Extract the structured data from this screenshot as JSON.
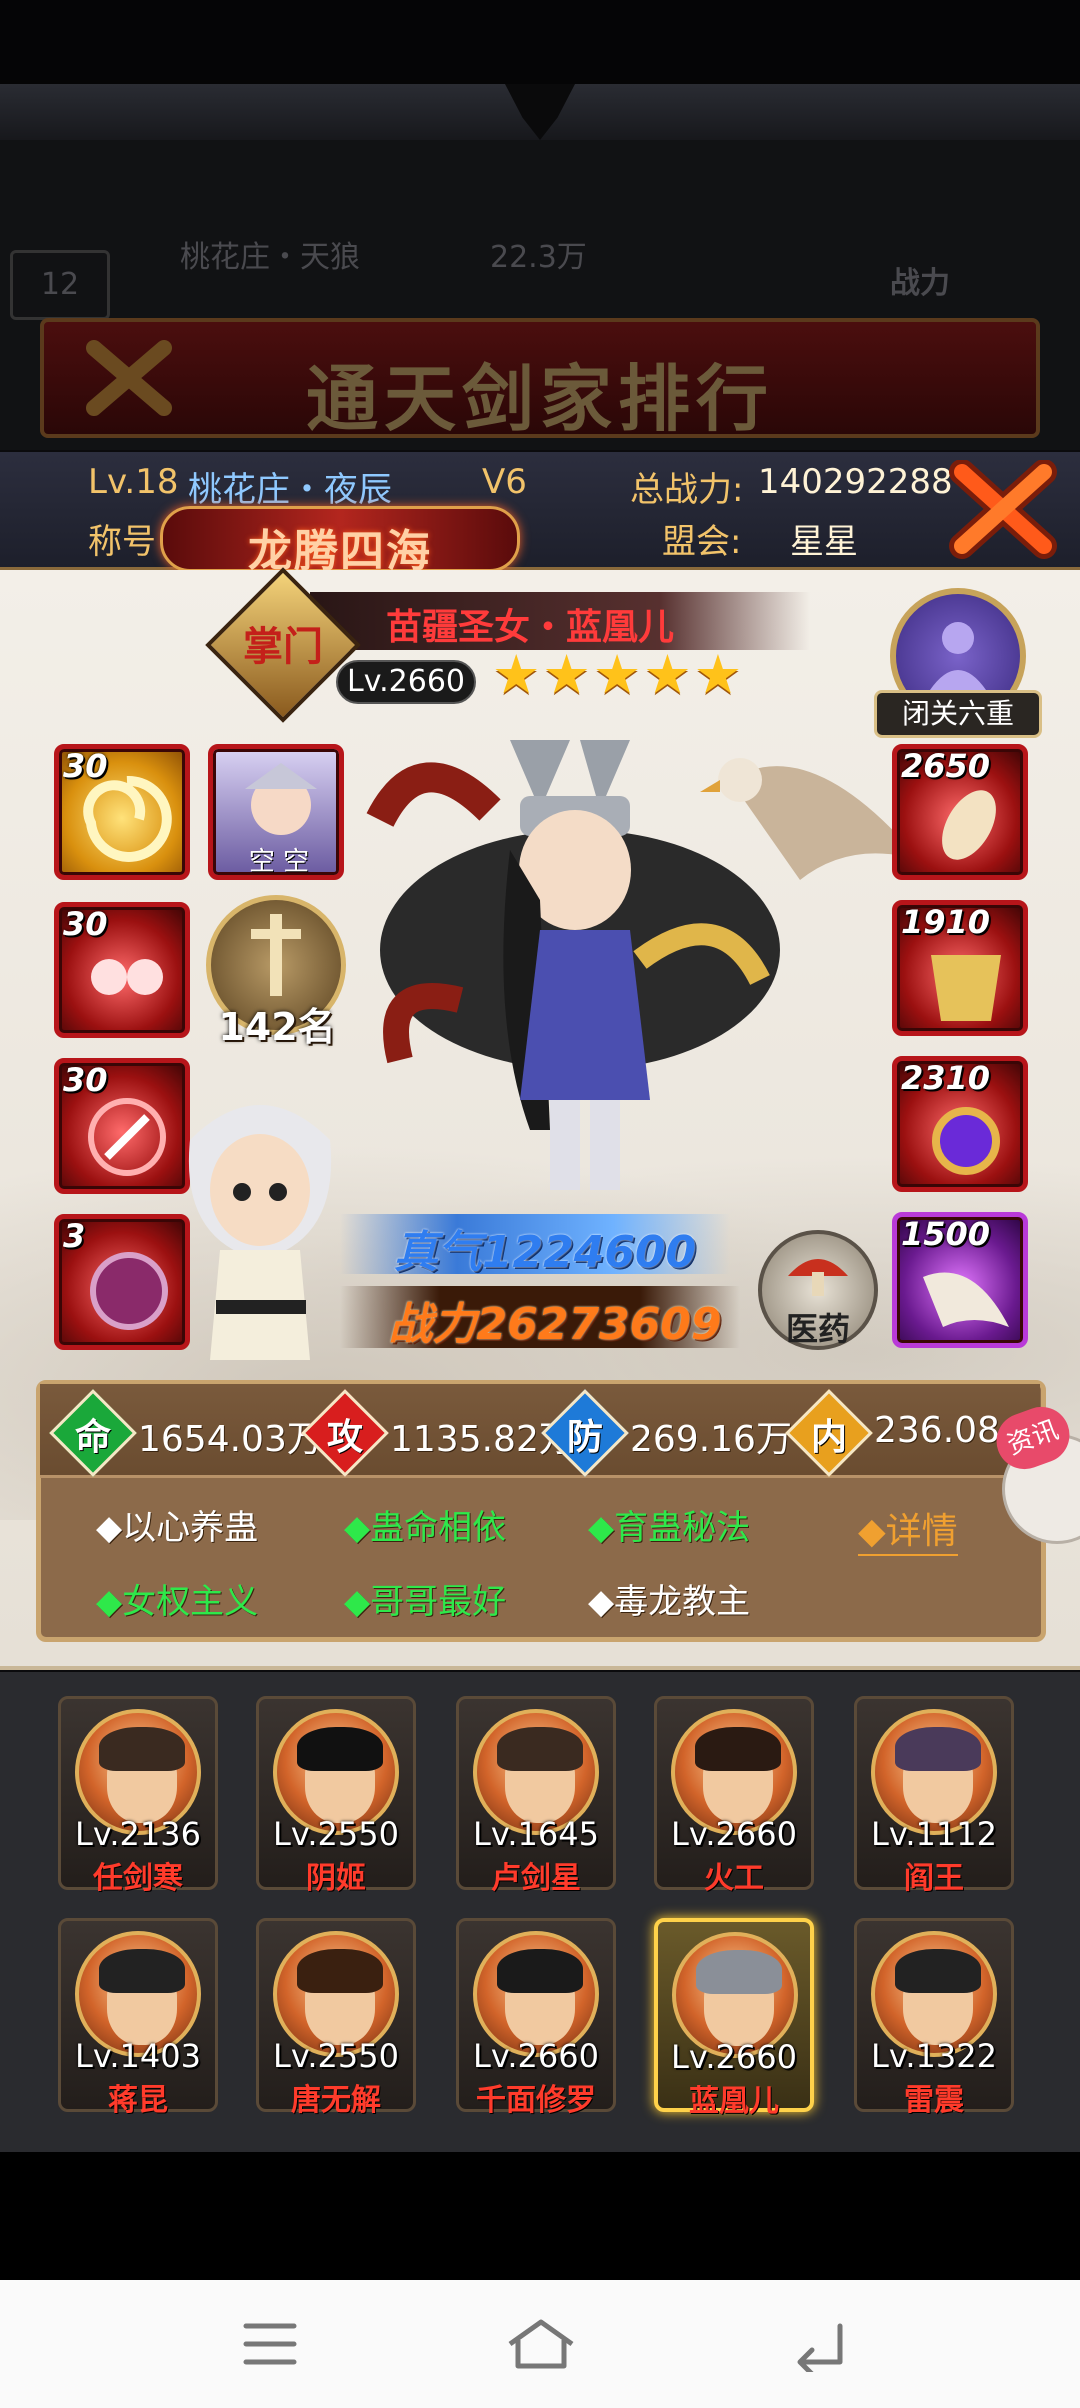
{
  "background": {
    "rank_title": "通天剑家排行",
    "row_text_1": "桃花庄・天狼",
    "row_text_2": "22.3万",
    "row_text_3": "战力",
    "row_rank": "12"
  },
  "header": {
    "level": "Lv.18",
    "player_name": "桃花庄・夜辰",
    "vip": "V6",
    "total_power_label": "总战力:",
    "total_power": "140292288",
    "title_label": "称号",
    "title_badge": "龙腾四海",
    "guild_label": "盟会:",
    "guild": "星星"
  },
  "hero": {
    "rank_glyph": "掌门",
    "name": "苗疆圣女・蓝凰儿",
    "level": "Lv.2660",
    "stars": 5,
    "meditation_label": "闭关六重",
    "ranking": "142名",
    "true_qi": "真气1224600",
    "combat_power": "战力26273609",
    "medicine_label": "医药"
  },
  "left_slots": [
    {
      "level": "30",
      "style": "gold"
    },
    {
      "level": "",
      "style": "red",
      "portrait_text": "空 空"
    },
    {
      "level": "30",
      "style": "red"
    },
    {
      "level": "30",
      "style": "red"
    },
    {
      "level": "3",
      "style": "red"
    }
  ],
  "right_slots": [
    {
      "level": "2650",
      "style": "red"
    },
    {
      "level": "1910",
      "style": "red"
    },
    {
      "level": "2310",
      "style": "red"
    },
    {
      "level": "1500",
      "style": "purple"
    }
  ],
  "stats": {
    "hp_icon": "命",
    "hp": "1654.03万",
    "atk_icon": "攻",
    "atk": "1135.82万",
    "def_icon": "防",
    "def": "269.16万",
    "inner_icon": "内",
    "inner": "236.08",
    "news_label": "资讯",
    "detail_label": "◆详情",
    "buffs": [
      {
        "text": "◆以心养蛊",
        "color": "white"
      },
      {
        "text": "◆蛊命相依",
        "color": "green"
      },
      {
        "text": "◆育蛊秘法",
        "color": "green"
      },
      {
        "text": "◆女权主义",
        "color": "green"
      },
      {
        "text": "◆哥哥最好",
        "color": "green"
      },
      {
        "text": "◆毒龙教主",
        "color": "white"
      }
    ]
  },
  "roster": [
    {
      "level": "Lv.2136",
      "name": "任剑寒"
    },
    {
      "level": "Lv.2550",
      "name": "阴姬"
    },
    {
      "level": "Lv.1645",
      "name": "卢剑星"
    },
    {
      "level": "Lv.2660",
      "name": "火工"
    },
    {
      "level": "Lv.1112",
      "name": "阎王"
    },
    {
      "level": "Lv.1403",
      "name": "蒋昆"
    },
    {
      "level": "Lv.2550",
      "name": "唐无解"
    },
    {
      "level": "Lv.2660",
      "name": "千面修罗"
    },
    {
      "level": "Lv.2660",
      "name": "蓝凰儿",
      "selected": true
    },
    {
      "level": "Lv.1322",
      "name": "雷震"
    }
  ],
  "colors": {
    "header_bg": "#2c2e3e",
    "panel_bg": "#f3efe8",
    "accent_gold": "#f2c36a",
    "name_red": "#ff3b3b",
    "buff_green": "#2ee84a"
  },
  "nav": {
    "menu_icon": "menu-icon",
    "home_icon": "home-icon",
    "back_icon": "back-icon"
  }
}
